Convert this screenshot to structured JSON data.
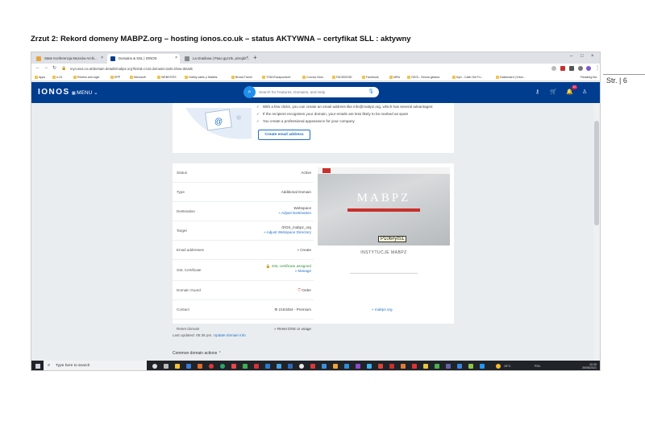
{
  "doc": {
    "heading": "Zrzut 2: Rekord domeny MABPZ.org – hosting ionos.co.uk – status AKTYWNA – certyfikat SLL : aktywny",
    "page_label": "Str. | 6"
  },
  "browser": {
    "tabs": [
      {
        "label": "State Konferencja Muzeów Archi...",
        "color": "#e8a33b"
      },
      {
        "label": "Domains & SSL | IONOS",
        "color": "#003d8f",
        "active": true
      },
      {
        "label": "La Gradiosa | Paso gyzzle, przejdz...",
        "color": "#888888"
      }
    ],
    "new_tab": "+",
    "url": "my.ionos.co.uk/domain-details/mabpz.org?linkId=ct.txt.domains.tools.show-details",
    "bookmarks": [
      "Apps",
      "n-24",
      "Review and login",
      "EPP",
      "Microsoft",
      "WEBSITES",
      "Hobby cafes y Wallets",
      "Bread-Travel",
      "TGM-Ruszpundure",
      "Corona Virus",
      "FACEBOOK",
      "Facebook",
      "MRA",
      "GEOI - Strona główna",
      "Kyiv - Cash Get Fo...",
      "Dashboard | Kiton..."
    ],
    "reading_list": "Reading list"
  },
  "ionos": {
    "logo": "IONOS",
    "menu": "MENU",
    "search_placeholder": "Search for Features, Domains, and Help",
    "notif_count": "10"
  },
  "email_card": {
    "bullets": [
      "With a few clicks, you can create an email address like info@mabpz.org, which has several advantages:",
      "If the recipient recognises your domain, your emails are less likely to be marked as spam",
      "You create a professional appearance for your company"
    ],
    "button": "Create email address"
  },
  "details": [
    {
      "label": "Status",
      "value": "Active"
    },
    {
      "label": "Type",
      "value": "Additional Domain"
    },
    {
      "label": "Destination",
      "value": "Webspace",
      "link": "» Adjust Destination"
    },
    {
      "label": "Target",
      "value": "/DOS_mabpz_org",
      "link": "» Adjust Webspace Directory"
    },
    {
      "label": "Email addresses",
      "link": "» Create"
    },
    {
      "label": "SSL Certificate",
      "value": "SSL certificate assigned",
      "link": "» Manage"
    },
    {
      "label": "Domain Guard",
      "value": "Order"
    },
    {
      "label": "Contact",
      "value": "2163454 - Premium"
    },
    {
      "label": "Reset domain",
      "link": "» Reset DNS or usage"
    }
  ],
  "preview": {
    "brand": "MABPZ",
    "tag": "P106#yIS1",
    "subtitle": "INSTYTUCJE MABPZ",
    "site_link": "» mabpz.org"
  },
  "last_updated": {
    "text": "Last updated: 05:36 pm.",
    "link": "Update domain info"
  },
  "common_actions": "Common domain actions",
  "taskbar": {
    "search_placeholder": "Type here to search",
    "weather": "19°C",
    "time": "10:30",
    "date": "26/08/2021",
    "lang": "POL"
  }
}
